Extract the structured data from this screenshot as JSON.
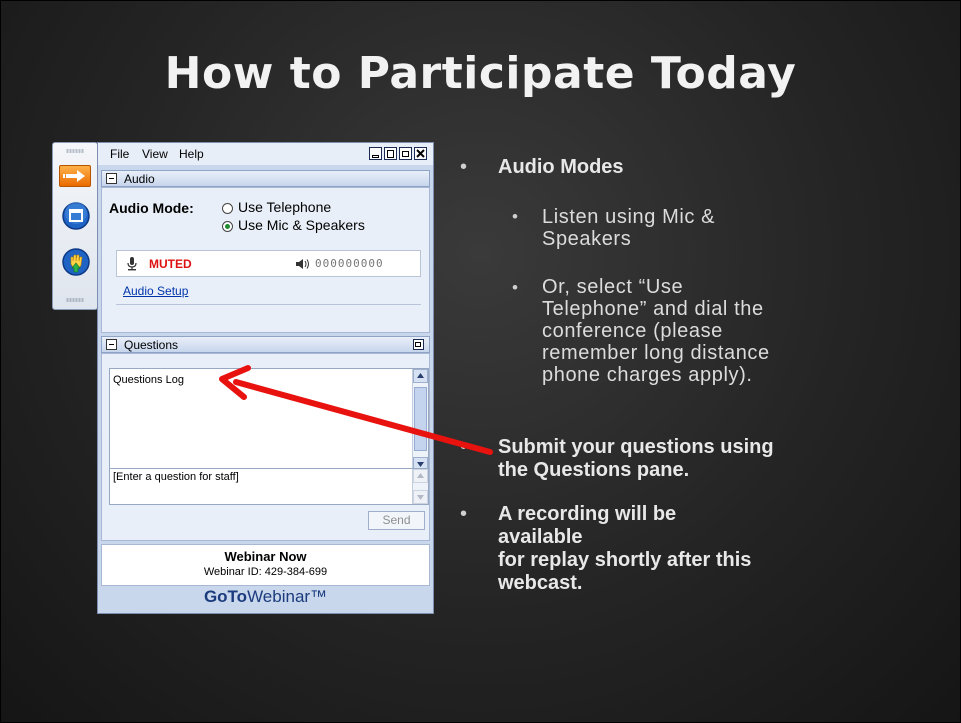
{
  "slide": {
    "title": "How to Participate Today"
  },
  "webinar_window": {
    "menu": [
      "File",
      "View",
      "Help"
    ],
    "audio_panel": {
      "header": "Audio",
      "audio_mode_label": "Audio Mode:",
      "options": [
        {
          "label": "Use Telephone",
          "selected": false
        },
        {
          "label": "Use Mic & Speakers",
          "selected": true
        }
      ],
      "muted_label": "MUTED",
      "level_digits": "000000000",
      "audio_setup_link": "Audio Setup"
    },
    "questions_panel": {
      "header": "Questions",
      "log_text": "Questions Log",
      "input_placeholder": "[Enter a question for staff]",
      "send_label": "Send"
    },
    "footer": {
      "title": "Webinar Now",
      "webinar_id": "Webinar ID: 429-384-699",
      "brand_bold": "GoTo",
      "brand_rest": "Webinar™"
    }
  },
  "bullets": {
    "audio_modes": "Audio Modes",
    "sub1_line1": "Listen using Mic &",
    "sub1_line2": "Speakers",
    "sub2_line1": "Or, select “Use",
    "sub2_line2": "Telephone” and dial the",
    "sub2_line3": "conference (please",
    "sub2_line4": "remember long distance",
    "sub2_line5": "phone charges apply).",
    "questions_line1": "Submit your questions using",
    "questions_line2": "the Questions pane.",
    "recording_line1": "A recording will be",
    "recording_line2": "available",
    "recording_line3": "for replay shortly after this",
    "recording_line4": "webcast."
  },
  "colors": {
    "muted_red": "#dd1111",
    "arrow_red": "#e8120f",
    "brand_blue": "#1a3b7c"
  }
}
